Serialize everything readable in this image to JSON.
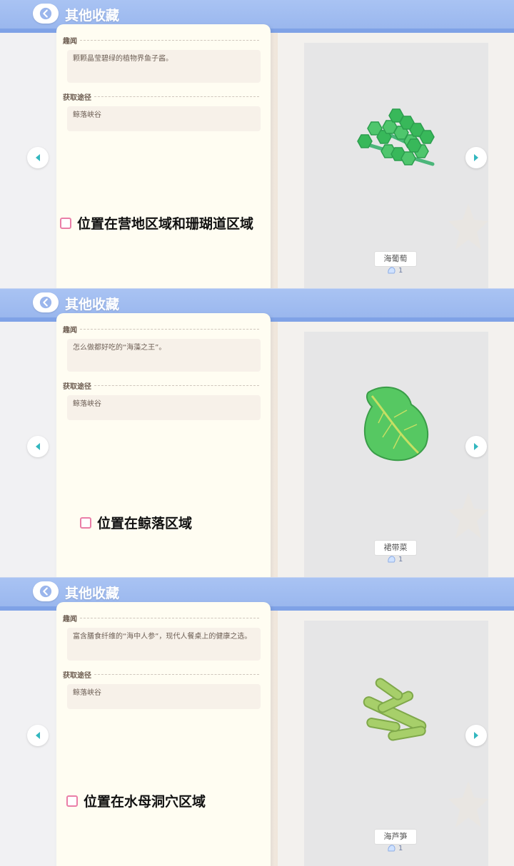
{
  "screens": [
    {
      "title": "其他收藏",
      "trivia_label": "趣闻",
      "trivia_text": "颗颗晶莹碧绿的植物界鱼子酱。",
      "source_label": "获取途径",
      "source_text": "鲸落峡谷",
      "note": "位置在营地区域和珊瑚道区域",
      "item_name": "海葡萄",
      "count": "1",
      "item_icon": "sea-grape-icon"
    },
    {
      "title": "其他收藏",
      "trivia_label": "趣闻",
      "trivia_text": "怎么做都好吃的“海藻之王”。",
      "source_label": "获取途径",
      "source_text": "鲸落峡谷",
      "note": "位置在鲸落区域",
      "item_name": "裙带菜",
      "count": "1",
      "item_icon": "wakame-icon"
    },
    {
      "title": "其他收藏",
      "trivia_label": "趣闻",
      "trivia_text": "富含膳食纤维的“海中人参”，现代人餐桌上的健康之选。",
      "source_label": "获取途径",
      "source_text": "鲸落峡谷",
      "note": "位置在水母洞穴区域",
      "item_name": "海芦笋",
      "count": "1",
      "item_icon": "sea-asparagus-icon"
    }
  ],
  "colors": {
    "topbar": "#a9c3f3",
    "accent": "#33b7bf",
    "checkbox": "#ea7ea7"
  }
}
